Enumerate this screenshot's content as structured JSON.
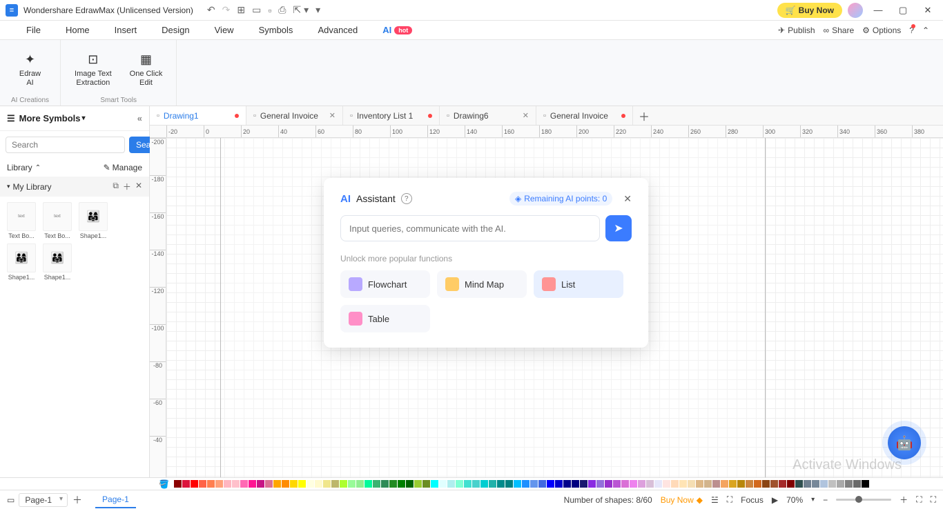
{
  "titlebar": {
    "app_title": "Wondershare EdrawMax (Unlicensed Version)",
    "buy_now": "Buy Now"
  },
  "menubar": {
    "items": [
      "File",
      "Home",
      "Insert",
      "Design",
      "View",
      "Symbols",
      "Advanced",
      "AI"
    ],
    "hot_badge": "hot",
    "publish": "Publish",
    "share": "Share",
    "options": "Options"
  },
  "ribbon": {
    "edraw_ai": "Edraw\nAI",
    "image_text": "Image Text\nExtraction",
    "one_click": "One Click\nEdit",
    "group1": "AI Creations",
    "group2": "Smart Tools"
  },
  "sidebar": {
    "header": "More Symbols",
    "search_placeholder": "Search",
    "search_btn": "Search",
    "library": "Library",
    "manage": "Manage",
    "my_library": "My Library",
    "shapes": [
      {
        "label": "Text Bo..."
      },
      {
        "label": "Text Bo..."
      },
      {
        "label": "Shape1..."
      },
      {
        "label": "Shape1..."
      },
      {
        "label": "Shape1..."
      }
    ]
  },
  "doc_tabs": [
    {
      "label": "Drawing1",
      "active": true,
      "dirty": true
    },
    {
      "label": "General Invoice",
      "active": false,
      "closable": true
    },
    {
      "label": "Inventory List 1",
      "active": false,
      "dirty": true
    },
    {
      "label": "Drawing6",
      "active": false,
      "closable": true
    },
    {
      "label": "General Invoice",
      "active": false,
      "dirty": true
    }
  ],
  "ruler_h": [
    "-20",
    "0",
    "20",
    "40",
    "60",
    "80",
    "100",
    "120",
    "140",
    "160",
    "180",
    "200",
    "220",
    "240",
    "260",
    "280",
    "300",
    "320",
    "340",
    "360",
    "380"
  ],
  "ruler_v": [
    "-200",
    "-180",
    "-160",
    "-140",
    "-120",
    "-100",
    "-80",
    "-60",
    "-40"
  ],
  "ai_panel": {
    "logo": "AI",
    "title": "Assistant",
    "points_label": "Remaining AI points: 0",
    "input_placeholder": "Input queries, communicate with the AI.",
    "subtitle": "Unlock more popular functions",
    "functions": [
      {
        "label": "Flowchart",
        "color": "#b8a9ff"
      },
      {
        "label": "Mind Map",
        "color": "#ffcc66"
      },
      {
        "label": "List",
        "color": "#ff9494",
        "selected": true
      },
      {
        "label": "Table",
        "color": "#ff8fc7"
      }
    ]
  },
  "colorbar": [
    "#8B0000",
    "#DC143C",
    "#FF0000",
    "#FF6347",
    "#FF7F50",
    "#FFA07A",
    "#FFB6C1",
    "#FFC0CB",
    "#FF69B4",
    "#FF1493",
    "#C71585",
    "#DB7093",
    "#FFA500",
    "#FF8C00",
    "#FFD700",
    "#FFFF00",
    "#FFFFE0",
    "#FFFACD",
    "#F0E68C",
    "#BDB76B",
    "#ADFF2F",
    "#98FB98",
    "#90EE90",
    "#00FA9A",
    "#3CB371",
    "#2E8B57",
    "#228B22",
    "#008000",
    "#006400",
    "#9ACD32",
    "#6B8E23",
    "#00FFFF",
    "#E0FFFF",
    "#AFEEEE",
    "#7FFFD4",
    "#40E0D0",
    "#48D1CC",
    "#00CED1",
    "#20B2AA",
    "#008B8B",
    "#008080",
    "#00BFFF",
    "#1E90FF",
    "#6495ED",
    "#4169E1",
    "#0000FF",
    "#0000CD",
    "#00008B",
    "#000080",
    "#191970",
    "#8A2BE2",
    "#9370DB",
    "#9932CC",
    "#BA55D3",
    "#DA70D6",
    "#EE82EE",
    "#DDA0DD",
    "#D8BFD8",
    "#E6E6FA",
    "#FFE4E1",
    "#FFDAB9",
    "#FFE4B5",
    "#F5DEB3",
    "#DEB887",
    "#D2B48C",
    "#BC8F8F",
    "#F4A460",
    "#DAA520",
    "#B8860B",
    "#CD853F",
    "#D2691E",
    "#8B4513",
    "#A0522D",
    "#A52A2A",
    "#800000",
    "#2F4F4F",
    "#708090",
    "#778899",
    "#B0C4DE",
    "#C0C0C0",
    "#A9A9A9",
    "#808080",
    "#696969",
    "#000000",
    "#FFFFFF"
  ],
  "statusbar": {
    "page_dropdown": "Page-1",
    "page_tab": "Page-1",
    "shapes_count": "Number of shapes: 8/60",
    "buy_now": "Buy Now",
    "focus": "Focus",
    "zoom": "70%"
  },
  "watermark": "Activate Windows"
}
